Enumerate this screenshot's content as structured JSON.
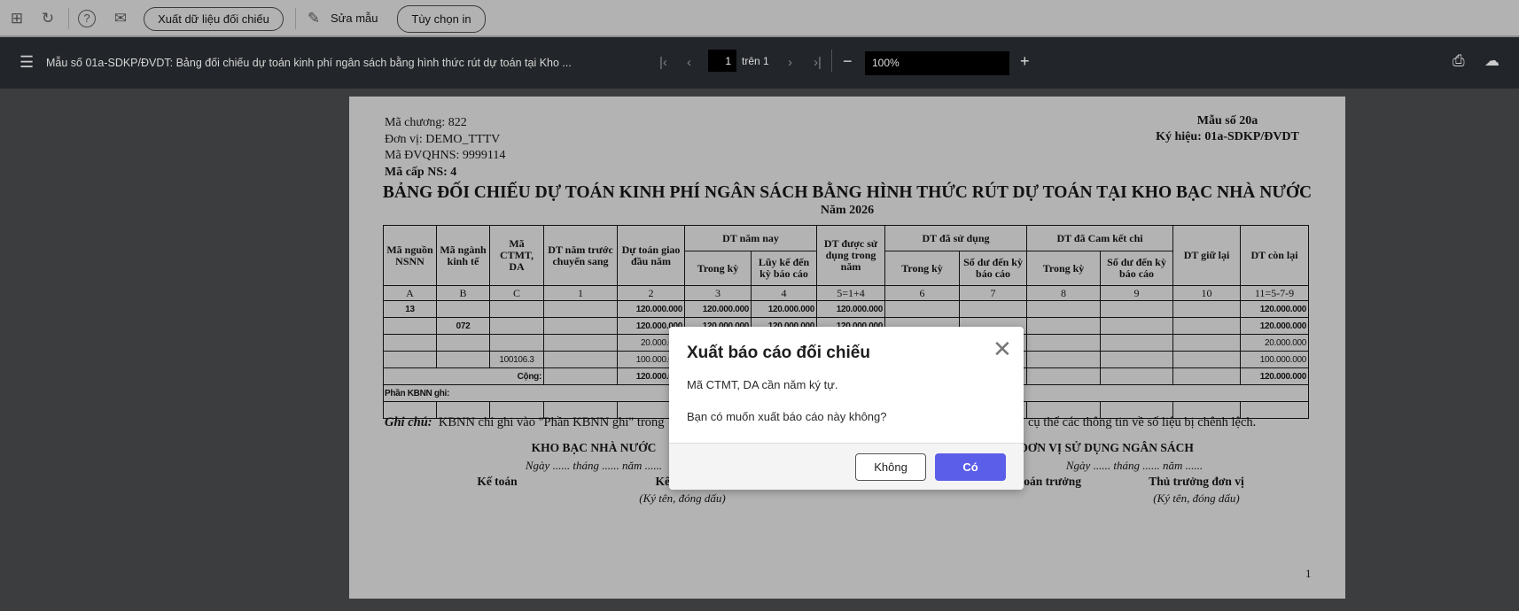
{
  "toolbar": {
    "export_button": "Xuất dữ liệu đối chiếu",
    "edit_template": "Sửa mẫu",
    "print_options": "Tùy chọn in"
  },
  "viewer": {
    "title": "Mẫu số 01a-SDKP/ĐVDT: Bảng đối chiếu dự toán kinh phí ngân sách bằng hình thức rút dự toán tại Kho ...",
    "page_current": "1",
    "page_total_label": "trên 1",
    "zoom": "100%"
  },
  "report": {
    "header_left": [
      "Mã chương: 822",
      "Đơn vị: DEMO_TTTV",
      "Mã ĐVQHNS: 9999114",
      "Mã cấp NS: 4"
    ],
    "form_no": "Mẫu số 20a",
    "symbol": "Ký hiệu: 01a-SDKP/ĐVDT",
    "title": "BẢNG ĐỐI CHIẾU DỰ TOÁN KINH PHÍ NGÂN SÁCH BẰNG HÌNH THỨC RÚT DỰ TOÁN TẠI KHO BẠC NHÀ NƯỚC",
    "year": "Năm 2026",
    "columns": {
      "c1": "Mã nguồn NSNN",
      "c2": "Mã ngành kinh tế",
      "c3": "Mã CTMT, DA",
      "c4": "DT năm trước chuyển sang",
      "c5": "Dự toán giao đầu năm",
      "g1": "DT năm nay",
      "g1a": "Trong kỳ",
      "g1b": "Lũy kế đến kỳ báo cáo",
      "c8": "DT được sử dụng trong năm",
      "g2": "DT đã sử dụng",
      "g2a": "Trong kỳ",
      "g2b": "Số dư đến kỳ báo cáo",
      "g3": "DT đã Cam kết chi",
      "g3a": "Trong kỳ",
      "g3b": "Số dư đến kỳ báo cáo",
      "c13": "DT giữ lại",
      "c14": "DT còn lại"
    },
    "letters": [
      "A",
      "B",
      "C",
      "1",
      "2",
      "3",
      "4",
      "5=1+4",
      "6",
      "7",
      "8",
      "9",
      "10",
      "11=5-7-9"
    ],
    "rows": [
      {
        "bold": true,
        "cells": [
          "13",
          "",
          "",
          "",
          "120.000.000",
          "120.000.000",
          "120.000.000",
          "120.000.000",
          "",
          "",
          "",
          "",
          "",
          "120.000.000"
        ]
      },
      {
        "bold": true,
        "cells": [
          "",
          "072",
          "",
          "",
          "120.000.000",
          "120.000.000",
          "120.000.000",
          "120.000.000",
          "",
          "",
          "",
          "",
          "",
          "120.000.000"
        ]
      },
      {
        "bold": false,
        "cells": [
          "",
          "",
          "",
          "",
          "20.000.000",
          "",
          "",
          "",
          "",
          "",
          "",
          "",
          "",
          "20.000.000"
        ]
      },
      {
        "bold": false,
        "cells": [
          "",
          "",
          "100106.3",
          "",
          "100.000.000",
          "",
          "",
          "",
          "",
          "",
          "",
          "",
          "",
          "100.000.000"
        ]
      }
    ],
    "total": {
      "label": "Cộng:",
      "c5": "120.000.000",
      "c14": "120.000.000"
    },
    "kbnn_section": "Phần KBNN ghi:",
    "note_label": "Ghi chú:",
    "note_left": "KBNN chỉ ghi vào \"Phần KBNN ghi\" trong",
    "note_right": "cụ thể các thông tin về số liệu bị chênh lệch.",
    "left_org": "KHO BẠC NHÀ NƯỚC",
    "left_date": "Ngày ...... tháng ...... năm ......",
    "left_sig1": "Kế toán",
    "left_sig2": "Kế toán trưởng",
    "left_sign_note": "(Ký tên, đóng dấu)",
    "right_org": "ĐƠN VỊ SỬ DỤNG NGÂN SÁCH",
    "right_date": "Ngày ...... tháng ...... năm ......",
    "right_sig1": "Kế toán trưởng",
    "right_sig2": "Thủ trưởng đơn vị",
    "right_sign_note": "(Ký tên, đóng dấu)",
    "page_number": "1"
  },
  "dialog": {
    "title": "Xuất báo cáo đối chiếu",
    "message1": "Mã CTMT, DA cần năm ký tự.",
    "message2": "Bạn có muốn xuất báo cáo này không?",
    "no": "Không",
    "yes": "Có",
    "accent": "#5b5ee8"
  }
}
